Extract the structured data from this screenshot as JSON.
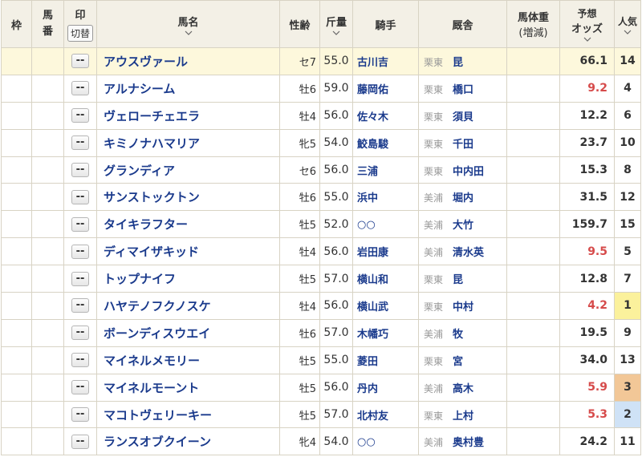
{
  "header": {
    "waku": "枠",
    "umaban": "馬\n番",
    "mark": "印",
    "kirikae": "切替",
    "name": "馬名",
    "sexage": "性齢",
    "kinryo": "斤量",
    "jockey": "騎手",
    "stable": "厩舎",
    "weight": "馬体重",
    "weight_sub": "(増減)",
    "odds_line1": "予想",
    "odds_line2": "オッズ",
    "ninki": "人気"
  },
  "mark_placeholder": "--",
  "colors": {
    "horse_link": "#1a3a8c",
    "popular_odds": "#d64b4b",
    "rank1_bg": "#fbf19c",
    "rank2_bg": "#cfe2f6",
    "rank3_bg": "#f2c797",
    "highlight_row": "#fdf8dc",
    "header_bg": "#f3f0e6"
  },
  "rows": [
    {
      "name": "アウスヴァール",
      "sexage": "セ7",
      "kinryo": "55.0",
      "jockey": "古川吉",
      "area": "栗東",
      "trainer": "昆",
      "odds": "66.1",
      "ninki": "14"
    },
    {
      "name": "アルナシーム",
      "sexage": "牡6",
      "kinryo": "59.0",
      "jockey": "藤岡佑",
      "area": "栗東",
      "trainer": "橋口",
      "odds": "9.2",
      "ninki": "4"
    },
    {
      "name": "ヴェローチェエラ",
      "sexage": "牡4",
      "kinryo": "56.0",
      "jockey": "佐々木",
      "area": "栗東",
      "trainer": "須貝",
      "odds": "12.2",
      "ninki": "6"
    },
    {
      "name": "キミノナハマリア",
      "sexage": "牝5",
      "kinryo": "54.0",
      "jockey": "鮫島駿",
      "area": "栗東",
      "trainer": "千田",
      "odds": "23.7",
      "ninki": "10"
    },
    {
      "name": "グランディア",
      "sexage": "セ6",
      "kinryo": "56.0",
      "jockey": "三浦",
      "area": "栗東",
      "trainer": "中内田",
      "odds": "15.3",
      "ninki": "8"
    },
    {
      "name": "サンストックトン",
      "sexage": "牡6",
      "kinryo": "55.0",
      "jockey": "浜中",
      "area": "美浦",
      "trainer": "堀内",
      "odds": "31.5",
      "ninki": "12"
    },
    {
      "name": "タイキラフター",
      "sexage": "牡5",
      "kinryo": "52.0",
      "jockey": "○○",
      "area": "美浦",
      "trainer": "大竹",
      "odds": "159.7",
      "ninki": "15"
    },
    {
      "name": "ディマイザキッド",
      "sexage": "牡4",
      "kinryo": "56.0",
      "jockey": "岩田康",
      "area": "美浦",
      "trainer": "清水英",
      "odds": "9.5",
      "ninki": "5"
    },
    {
      "name": "トップナイフ",
      "sexage": "牡5",
      "kinryo": "57.0",
      "jockey": "横山和",
      "area": "栗東",
      "trainer": "昆",
      "odds": "12.8",
      "ninki": "7"
    },
    {
      "name": "ハヤテノフクノスケ",
      "sexage": "牡4",
      "kinryo": "56.0",
      "jockey": "横山武",
      "area": "栗東",
      "trainer": "中村",
      "odds": "4.2",
      "ninki": "1"
    },
    {
      "name": "ボーンディスウエイ",
      "sexage": "牡6",
      "kinryo": "57.0",
      "jockey": "木幡巧",
      "area": "美浦",
      "trainer": "牧",
      "odds": "19.5",
      "ninki": "9"
    },
    {
      "name": "マイネルメモリー",
      "sexage": "牡5",
      "kinryo": "55.0",
      "jockey": "菱田",
      "area": "栗東",
      "trainer": "宮",
      "odds": "34.0",
      "ninki": "13"
    },
    {
      "name": "マイネルモーント",
      "sexage": "牡5",
      "kinryo": "56.0",
      "jockey": "丹内",
      "area": "美浦",
      "trainer": "高木",
      "odds": "5.9",
      "ninki": "3"
    },
    {
      "name": "マコトヴェリーキー",
      "sexage": "牡5",
      "kinryo": "57.0",
      "jockey": "北村友",
      "area": "栗東",
      "trainer": "上村",
      "odds": "5.3",
      "ninki": "2"
    },
    {
      "name": "ランスオブクイーン",
      "sexage": "牝4",
      "kinryo": "54.0",
      "jockey": "○○",
      "area": "美浦",
      "trainer": "奥村豊",
      "odds": "24.2",
      "ninki": "11"
    }
  ]
}
